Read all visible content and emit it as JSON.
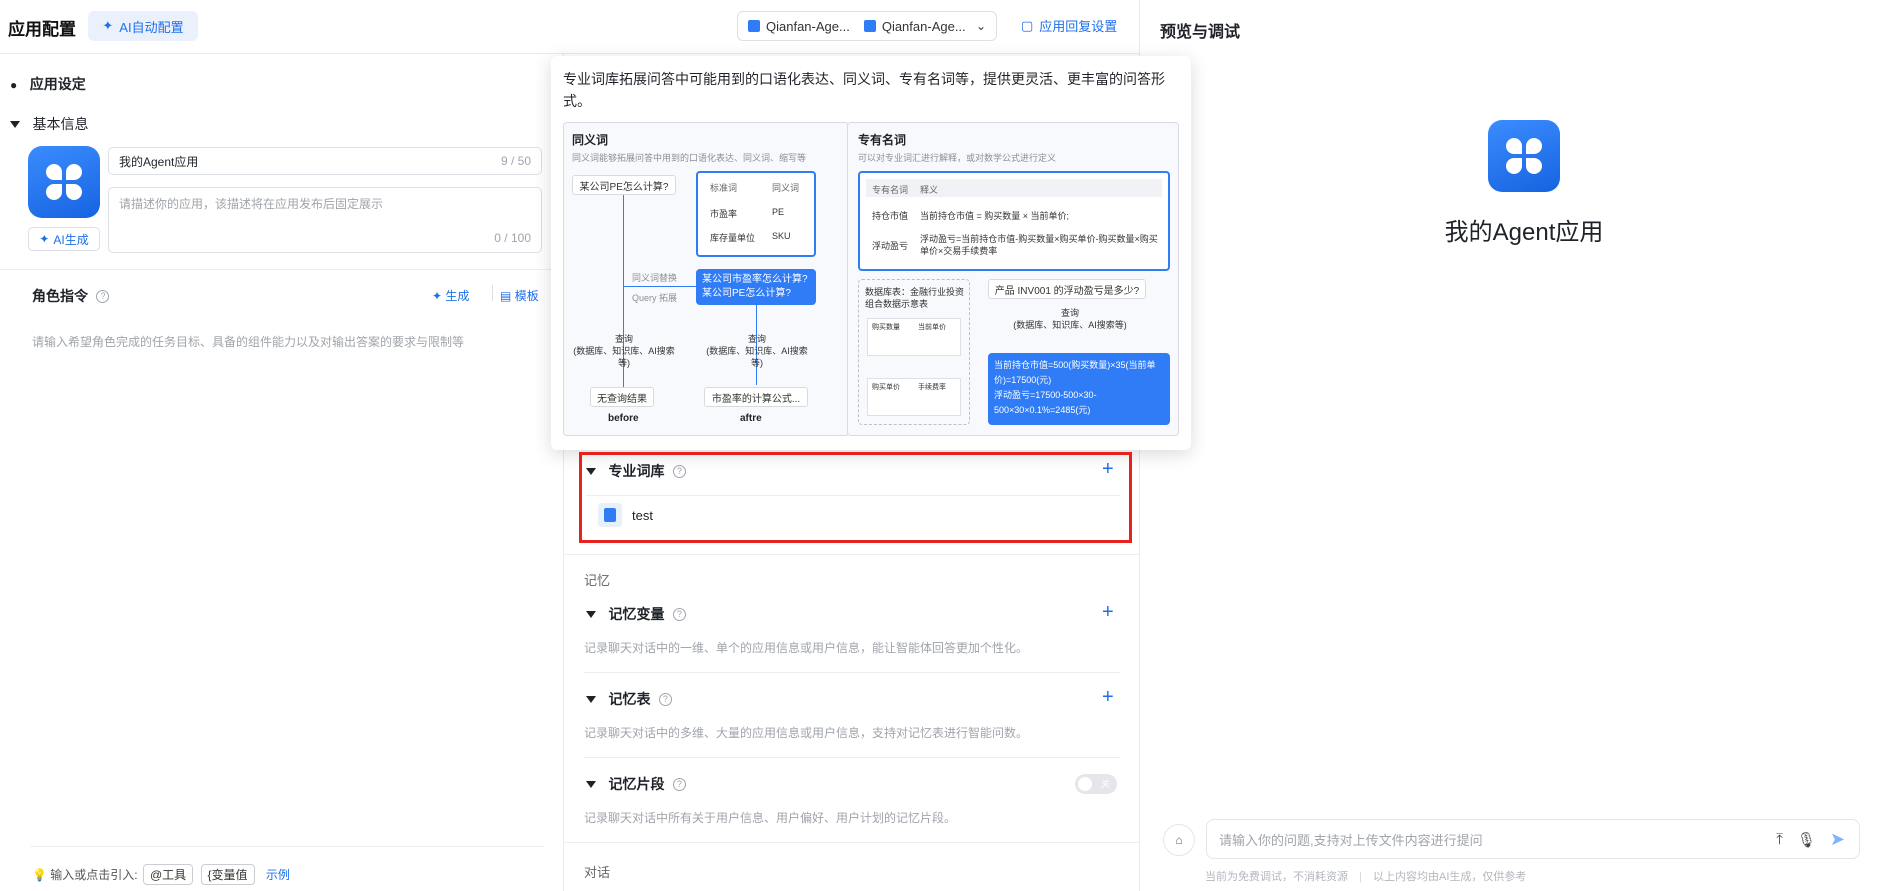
{
  "header": {
    "title": "应用配置",
    "ai_auto_config": "AI自动配置",
    "model_a": "Qianfan-Age...",
    "model_b": "Qianfan-Age...",
    "reply_settings": "应用回复设置"
  },
  "left": {
    "app_settings": "应用设定",
    "basic_info": "基本信息",
    "app_name": "我的Agent应用",
    "name_count": "9 / 50",
    "desc_placeholder": "请描述你的应用，该描述将在应用发布后固定展示",
    "desc_count": "0 / 100",
    "ai_generate": "AI生成",
    "role_instruction": "角色指令",
    "generate": "生成",
    "template": "模板",
    "role_placeholder": "请输入希望角色完成的任务目标、具备的组件能力以及对输出答案的要求与限制等",
    "input_hint": "输入或点击引入:",
    "tool_chip": "@工具",
    "var_chip": "{变量值",
    "example": "示例"
  },
  "tooltip": {
    "text": "专业词库拓展问答中可能用到的口语化表达、同义词、专有名词等，提供更灵活、更丰富的问答形式。",
    "synonyms": {
      "title": "同义词",
      "sub": "同义词能够拓展问答中用到的口语化表达、同义词、缩写等",
      "question": "某公司PE怎么计算?",
      "col1": "标准词",
      "col2": "同义词",
      "row1a": "市盈率",
      "row1b": "PE",
      "row2a": "库存量单位",
      "row2b": "SKU",
      "replace": "同义词替换",
      "query_expand": "Query 拓展",
      "expanded1": "某公司市盈率怎么计算?",
      "expanded2": "某公司PE怎么计算?",
      "query1": "查询",
      "query1_sub": "(数据库、知识库、AI搜索等)",
      "query2": "查询",
      "query2_sub": "(数据库、知识库、AI搜索等)",
      "no_result": "无查询结果",
      "result": "市盈率的计算公式...",
      "before": "before",
      "after": "aftre"
    },
    "terms": {
      "title": "专有名词",
      "sub": "可以对专业词汇进行解释，或对数学公式进行定义",
      "col1": "专有名词",
      "col2": "释义",
      "row1a": "持仓市值",
      "row1b": "当前持仓市值 = 购买数量 × 当前单价;",
      "row2a": "浮动盈亏",
      "row2b": "浮动盈亏=当前持仓市值-购买数量×购买单价-购买数量×购买单价×交易手续费率",
      "db_label": "数据库表：金融行业投资组合数据示意表",
      "t1c1": "购买数量",
      "t1c2": "当前单价",
      "t2c1": "购买单价",
      "t2c2": "手续费率",
      "question": "产品 INV001 的浮动盈亏是多少?",
      "query": "查询",
      "query_sub": "(数据库、知识库、AI搜索等)",
      "answer": "当前持仓市值=500(购买数量)×35(当前单价)=17500(元)\n浮动盈亏=17500-500×30-500×30×0.1%=2485(元)"
    }
  },
  "mid": {
    "lexicon_title": "专业词库",
    "lexicon_item": "test",
    "memory_section": "记忆",
    "memory_var_title": "记忆变量",
    "memory_var_desc": "记录聊天对话中的一维、单个的应用信息或用户信息，能让智能体回答更加个性化。",
    "memory_table_title": "记忆表",
    "memory_table_desc": "记录聊天对话中的多维、大量的应用信息或用户信息，支持对记忆表进行智能问数。",
    "memory_snippet_title": "记忆片段",
    "memory_snippet_desc": "记录聊天对话中所有关于用户信息、用户偏好、用户计划的记忆片段。",
    "toggle_label": "关",
    "dialog_section": "对话"
  },
  "preview": {
    "title": "预览与调试",
    "app_name": "我的Agent应用",
    "input_placeholder": "请输入你的问题,支持对上传文件内容进行提问",
    "note1": "当前为免费调试，不消耗资源",
    "note2": "以上内容均由AI生成，仅供参考"
  },
  "colors": {
    "accent": "#1f6feb",
    "highlight": "#e6211e"
  }
}
